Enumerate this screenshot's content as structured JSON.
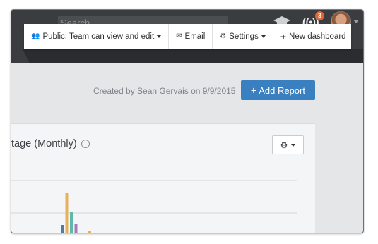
{
  "navbar": {
    "search_placeholder": "Search",
    "notification_count": "3",
    "broadcast_icon": "((•))",
    "icons": [
      "graduation-cap-icon",
      "broadcast-icon",
      "avatar"
    ]
  },
  "toolbar": {
    "items": [
      {
        "icon": "people-icon",
        "glyph": "👥",
        "label": "Public: Team can view and edit",
        "caret": true
      },
      {
        "icon": "mail-icon",
        "glyph": "✉",
        "label": "Email",
        "caret": false
      },
      {
        "icon": "gear-icon",
        "glyph": "⚙",
        "label": "Settings",
        "caret": true
      },
      {
        "icon": "plus-icon",
        "glyph": "+",
        "label": "New dashboard",
        "caret": false
      }
    ]
  },
  "header": {
    "created_by": "Created by Sean Gervais on 9/9/2015",
    "add_report_label": "Add Report",
    "add_report_color": "#3a7fc0"
  },
  "card": {
    "title": "tage (Monthly)",
    "info_icon": "i"
  },
  "chart_data": {
    "type": "bar",
    "colors": [
      "#4a7fa6",
      "#e8b05c",
      "#5fb9a8",
      "#a27db6",
      "#e8b05c"
    ],
    "values": [
      0.15,
      0.72,
      0.38,
      0.17,
      0.04
    ],
    "grid": true
  }
}
